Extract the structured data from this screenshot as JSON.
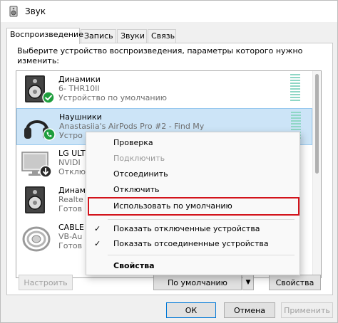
{
  "window": {
    "title": "Звук",
    "icon": "speaker-icon"
  },
  "tabs": [
    {
      "label": "Воспроизведение",
      "active": true
    },
    {
      "label": "Запись",
      "active": false
    },
    {
      "label": "Звуки",
      "active": false
    },
    {
      "label": "Связь",
      "active": false
    }
  ],
  "instruction": "Выберите устройство воспроизведения, параметры которого нужно изменить:",
  "devices": [
    {
      "name": "Динамики",
      "sub": "6- THR10II",
      "status": "Устройство по умолчанию",
      "icon": "speaker-icon",
      "badge": "green-check-icon"
    },
    {
      "name": "Наушники",
      "sub": "Anastasiia's AirPods Pro #2 - Find My",
      "status": "Устро",
      "icon": "headphones-icon",
      "badge": "green-phone-icon",
      "selected": true
    },
    {
      "name": "LG ULT",
      "sub": "NVIDI",
      "status": "Отклю",
      "icon": "monitor-icon",
      "badge": "down-arrow-icon"
    },
    {
      "name": "Динам",
      "sub": "Realte",
      "status": "Готов",
      "icon": "speaker-icon"
    },
    {
      "name": "CABLE",
      "sub": "VB-Au",
      "status": "Готов",
      "icon": "cable-icon"
    }
  ],
  "context_menu": {
    "items": [
      {
        "label": "Проверка"
      },
      {
        "label": "Подключить",
        "disabled": true
      },
      {
        "label": "Отсоединить"
      },
      {
        "label": "Отключить"
      },
      {
        "label": "Использовать по умолчанию",
        "highlighted": true
      },
      {
        "label": "Показать отключенные устройства",
        "checked": true
      },
      {
        "label": "Показать отсоединенные устройства",
        "checked": true
      },
      {
        "label": "Свойства",
        "bold": true
      }
    ],
    "check_glyph": "✓"
  },
  "buttons": {
    "configure": "Настроить",
    "default": "По умолчанию",
    "default_arrow": "▼",
    "properties": "Свойства",
    "ok": "ОК",
    "cancel": "Отмена",
    "apply": "Применить"
  },
  "colors": {
    "selection": "#cce4f7",
    "highlight_border": "#d3131b",
    "level_meter": "#8fd7c6"
  }
}
